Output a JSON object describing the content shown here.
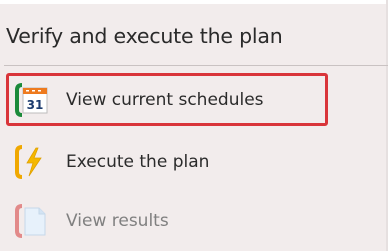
{
  "panel": {
    "title": "Verify and execute the plan"
  },
  "items": [
    {
      "label": "View current schedules",
      "icon": "calendar-icon",
      "icon_text": "31",
      "accent": "#1b8a3a",
      "selected": true
    },
    {
      "label": "Execute the plan",
      "icon": "lightning-bolt-icon",
      "accent": "#f0a800",
      "selected": false
    },
    {
      "label": "View results",
      "icon": "document-icon",
      "accent": "#e28a8a",
      "selected": false,
      "disabled": true
    }
  ],
  "colors": {
    "highlight": "#d9353a",
    "panel_bg": "#f2ecec"
  }
}
